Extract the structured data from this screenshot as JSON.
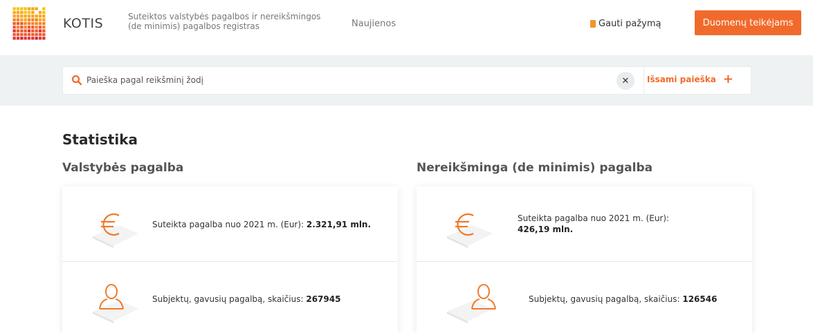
{
  "header": {
    "brand": "KOTIS",
    "tagline_line1": "Suteiktos valstybės pagalbos ir nereikšmingos",
    "tagline_line2": "(de minimis) pagalbos registras",
    "news_label": "Naujienos",
    "certificate_label": "Gauti pažymą",
    "cta_label": "Duomenų teikėjams"
  },
  "search": {
    "placeholder": "Paieška pagal reikšminį žodį",
    "clear_symbol": "✕",
    "advanced_label": "Išsami paieška",
    "advanced_symbol": "+"
  },
  "statistics": {
    "title": "Statistika",
    "state_aid": {
      "title": "Valstybės pagalba",
      "amount_label": "Suteikta pagalba nuo 2021 m. (Eur):",
      "amount_value": "2.321,91 mln.",
      "subjects_label": "Subjektų, gavusių pagalbą, skaičius:",
      "subjects_value": "267945"
    },
    "de_minimis": {
      "title": "Nereikšminga (de minimis) pagalba",
      "amount_label": "Suteikta pagalba nuo 2021 m. (Eur):",
      "amount_value": "426,19 mln.",
      "subjects_label": "Subjektų, gavusių pagalbą, skaičius:",
      "subjects_value": "126546"
    }
  },
  "colors": {
    "accent": "#f26a2b",
    "icon_orange": "#f07a2a",
    "band": "#eef2f3"
  },
  "icons": [
    "logo-mosaic",
    "document-icon",
    "search-icon",
    "close-icon",
    "plus-icon",
    "euro-icon",
    "person-icon"
  ]
}
